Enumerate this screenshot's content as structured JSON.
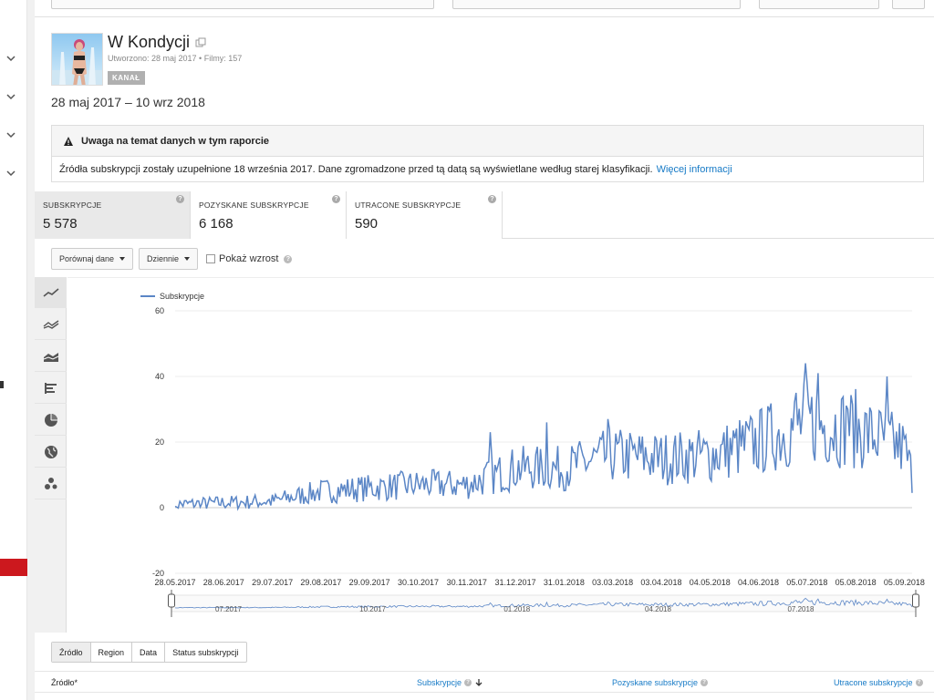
{
  "channel": {
    "title": "W Kondycji",
    "meta": "Utworzono: 28 maj 2017 • Filmy: 157",
    "badge": "KANAŁ"
  },
  "date_range": "28 maj 2017 – 10 wrz 2018",
  "notice": {
    "heading": "Uwaga na temat danych w tym raporcie",
    "body": "Źródła subskrypcji zostały uzupełnione 18 września 2017. Dane zgromadzone przed tą datą są wyświetlane według starej klasyfikacji.",
    "link": "Więcej informacji"
  },
  "metrics": [
    {
      "label": "SUBSKRYPCJE",
      "value": "5 578"
    },
    {
      "label": "POZYSKANE SUBSKRYPCJE",
      "value": "6 168"
    },
    {
      "label": "UTRACONE SUBSKRYPCJE",
      "value": "590"
    }
  ],
  "controls": {
    "compare": "Porównaj dane",
    "interval": "Dziennie",
    "growth": "Pokaż wzrost"
  },
  "bottom_tabs": [
    "Źródło",
    "Region",
    "Data",
    "Status subskrypcji"
  ],
  "table": {
    "col_source": "Źródło*",
    "col_subs": "Subskrypcje",
    "col_gained": "Pozyskane subskrypcje",
    "col_lost": "Utracone subskrypcje"
  },
  "colors": {
    "line": "#5b86c6",
    "accent": "#167ac6",
    "active_nav": "#cc181e"
  },
  "chart_data": {
    "type": "line",
    "series": [
      {
        "name": "Subskrypcje"
      }
    ],
    "ylim": [
      -20,
      60
    ],
    "yticks": [
      -20,
      0,
      20,
      40,
      60
    ],
    "xlabels": [
      "28.05.2017",
      "28.06.2017",
      "29.07.2017",
      "29.08.2017",
      "29.09.2017",
      "30.10.2017",
      "30.11.2017",
      "31.12.2017",
      "31.01.2018",
      "03.03.2018",
      "03.04.2018",
      "04.05.2018",
      "04.06.2018",
      "05.07.2018",
      "05.08.2018",
      "05.09.2018"
    ],
    "navigator_labels": [
      "07.2017",
      "10.2017",
      "01.2018",
      "04.2018",
      "07.2018"
    ],
    "anchors": [
      {
        "date": "28.05.2017",
        "value": 1
      },
      {
        "date": "28.06.2017",
        "value": 1.5
      },
      {
        "date": "29.07.2017",
        "value": 2
      },
      {
        "date": "29.08.2017",
        "value": 5
      },
      {
        "date": "29.09.2017",
        "value": 6
      },
      {
        "date": "30.10.2017",
        "value": 7
      },
      {
        "date": "30.11.2017",
        "value": 7
      },
      {
        "date": "31.12.2017",
        "value": 12
      },
      {
        "date": "31.01.2018",
        "value": 12
      },
      {
        "date": "03.03.2018",
        "value": 16
      },
      {
        "date": "03.04.2018",
        "value": 15
      },
      {
        "date": "04.05.2018",
        "value": 16
      },
      {
        "date": "04.06.2018",
        "value": 20
      },
      {
        "date": "05.07.2018",
        "value": 26
      },
      {
        "date": "05.08.2018",
        "value": 24
      },
      {
        "date": "05.09.2018",
        "value": 18
      },
      {
        "date": "10.09.2018",
        "value": 10
      }
    ],
    "peaks": [
      {
        "date": "15.12.2017",
        "value": 23
      },
      {
        "date": "20.01.2018",
        "value": 26
      },
      {
        "date": "28.02.2018",
        "value": 27
      },
      {
        "date": "28.06.2018",
        "value": 35
      },
      {
        "date": "04.07.2018",
        "value": 44
      },
      {
        "date": "12.07.2018",
        "value": 41
      },
      {
        "date": "31.07.2018",
        "value": 30
      },
      {
        "date": "25.08.2018",
        "value": 40
      }
    ]
  }
}
